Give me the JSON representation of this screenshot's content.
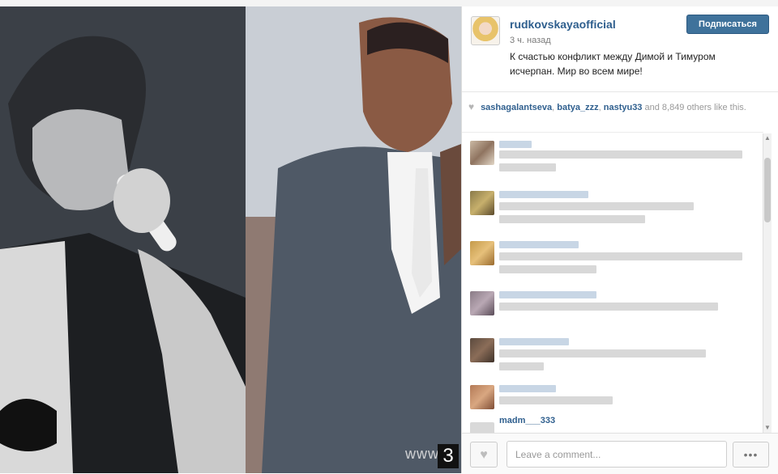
{
  "post": {
    "username": "rudkovskayaofficial",
    "timestamp": "3 ч. назад",
    "caption": "К счастью конфликт между Димой и Тимуром исчерпан. Мир во всем мире!",
    "follow_label": "Подписаться"
  },
  "photo": {
    "watermark": "www",
    "number": "3"
  },
  "likes": {
    "users": [
      "sashagalantseva",
      "batya_zzz",
      "nastyu33"
    ],
    "sep1": ", ",
    "sep2": ", ",
    "rest": " and 8,849 others like this."
  },
  "comments": {
    "last_visible_name": "madm___333"
  },
  "footer": {
    "comment_placeholder": "Leave a comment...",
    "more_label": "•••"
  },
  "colors": {
    "link": "#2f5f8e",
    "follow_button": "#3f729b"
  },
  "icons": {
    "heart": "heart-icon",
    "more": "more-icon",
    "scroll_up": "scroll-up-icon",
    "scroll_down": "scroll-down-icon"
  }
}
